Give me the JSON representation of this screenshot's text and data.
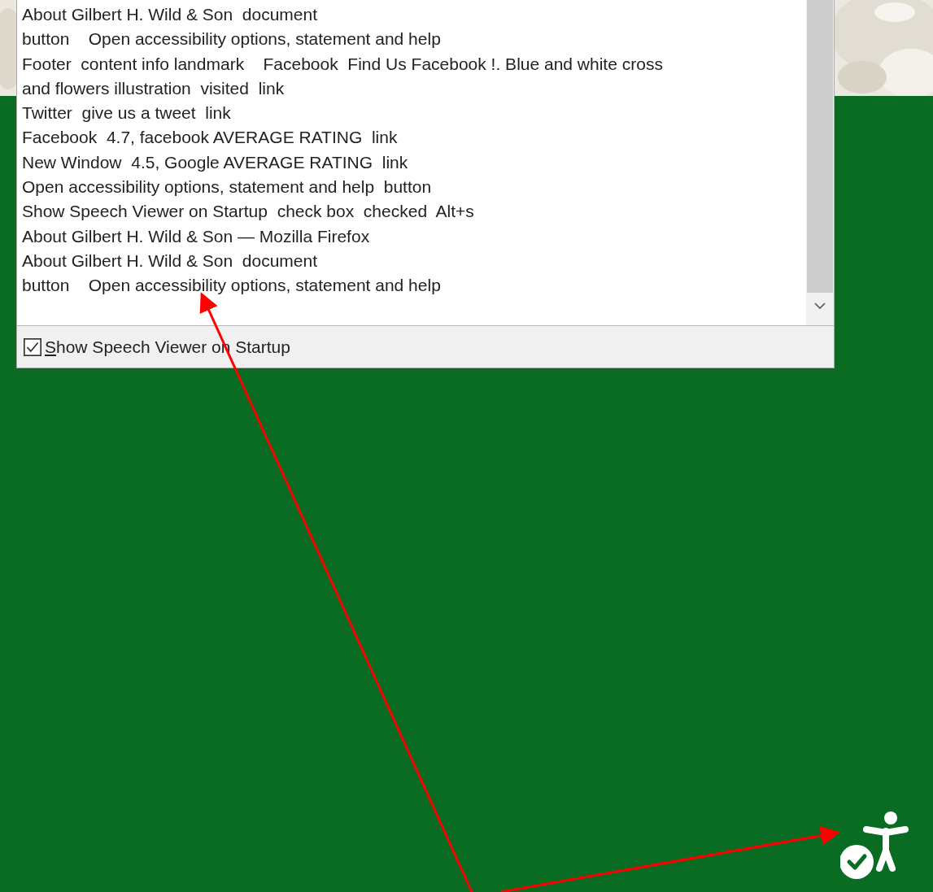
{
  "speech_viewer": {
    "lines": [
      "About Gilbert H. Wild & Son  document",
      "button    Open accessibility options, statement and help",
      "Footer  content info landmark    Facebook  Find Us Facebook !. Blue and white cross",
      "and flowers illustration  visited  link",
      "Twitter  give us a tweet  link",
      "Facebook  4.7, facebook AVERAGE RATING  link",
      "New Window  4.5, Google AVERAGE RATING  link",
      "Open accessibility options, statement and help  button",
      "Show Speech Viewer on Startup  check box  checked  Alt+s",
      "About Gilbert H. Wild & Son — Mozilla Firefox",
      "About Gilbert H. Wild & Son  document",
      "button    Open accessibility options, statement and help"
    ],
    "startup_checkbox": {
      "access_key": "S",
      "label_rest": "how Speech Viewer on Startup",
      "checked": true
    }
  }
}
